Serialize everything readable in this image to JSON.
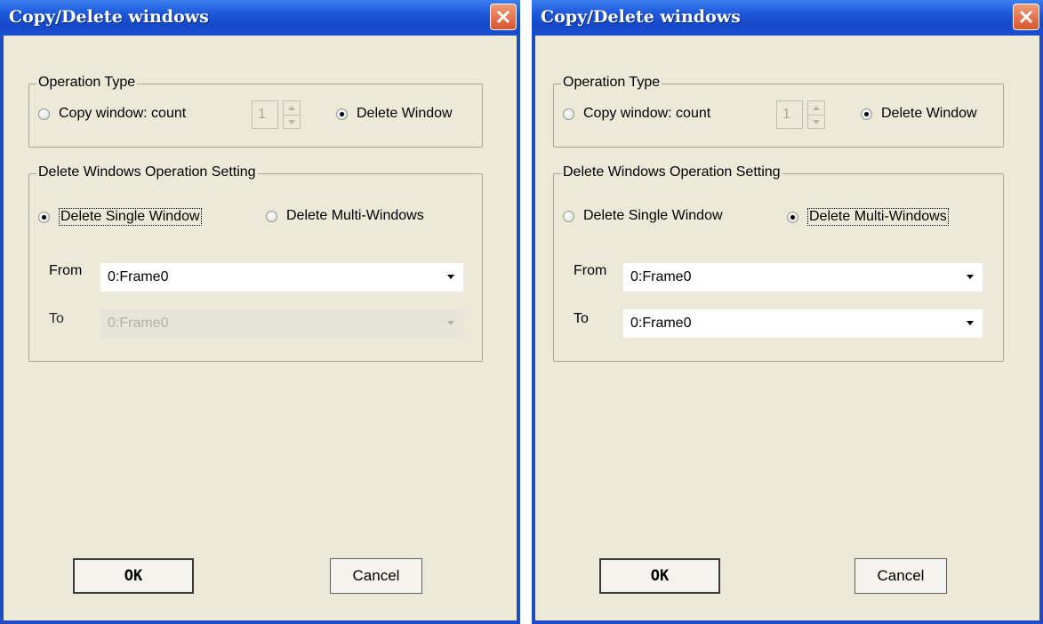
{
  "dialogs": [
    {
      "title": "Copy/Delete windows",
      "operation_type": {
        "legend": "Operation Type",
        "copy_label": "Copy window: count",
        "copy_selected": false,
        "count_value": "1",
        "delete_label": "Delete Window",
        "delete_selected": true
      },
      "delete_settings": {
        "legend": "Delete Windows Operation Setting",
        "single_label": "Delete Single Window",
        "single_selected": true,
        "multi_label": "Delete Multi-Windows",
        "multi_selected": false,
        "from_label": "From",
        "from_value": "0:Frame0",
        "to_label": "To",
        "to_value": "0:Frame0",
        "to_enabled": false
      },
      "ok_label": "OK",
      "cancel_label": "Cancel"
    },
    {
      "title": "Copy/Delete windows",
      "operation_type": {
        "legend": "Operation Type",
        "copy_label": "Copy window: count",
        "copy_selected": false,
        "count_value": "1",
        "delete_label": "Delete Window",
        "delete_selected": true
      },
      "delete_settings": {
        "legend": "Delete Windows Operation Setting",
        "single_label": "Delete Single Window",
        "single_selected": false,
        "multi_label": "Delete Multi-Windows",
        "multi_selected": true,
        "from_label": "From",
        "from_value": "0:Frame0",
        "to_label": "To",
        "to_value": "0:Frame0",
        "to_enabled": true
      },
      "ok_label": "OK",
      "cancel_label": "Cancel"
    }
  ],
  "colors": {
    "titlebar": "#1f5bdc",
    "client_bg": "#ece9d8",
    "close_button": "#d8542c"
  },
  "icons": {
    "close": "close-icon",
    "spin_up": "spin-up-icon",
    "spin_down": "spin-down-icon",
    "dropdown": "chevron-down-icon"
  }
}
